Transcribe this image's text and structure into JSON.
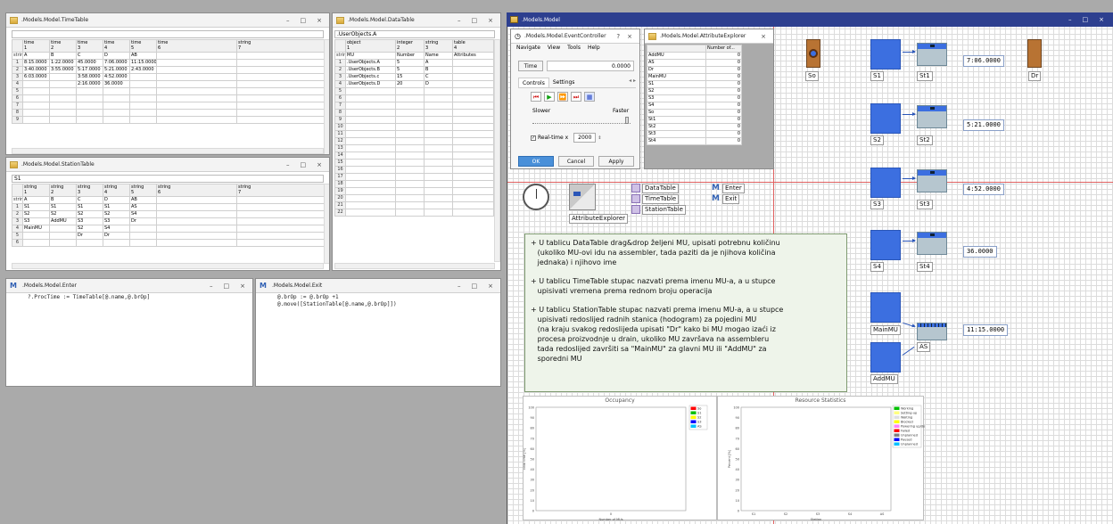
{
  "windows": {
    "timetable": {
      "title": ".Models.Model.TimeTable",
      "input": "",
      "headers": [
        {
          "type": "time",
          "idx": "1"
        },
        {
          "type": "time",
          "idx": "2"
        },
        {
          "type": "time",
          "idx": "3"
        },
        {
          "type": "time",
          "idx": "4"
        },
        {
          "type": "time",
          "idx": "5"
        },
        {
          "type": "time",
          "idx": "6"
        },
        {
          "type": "string",
          "idx": "7"
        }
      ],
      "subrow_label": "string",
      "subheaders": [
        "A",
        "B",
        "C",
        "D",
        "AB",
        "",
        ""
      ],
      "rows": [
        [
          "1",
          "8:15.0000",
          "1:22.0000",
          "45.0000",
          "7:06.0000",
          "11:15.0000",
          "",
          ""
        ],
        [
          "2",
          "3:40.0000",
          "3:55.0000",
          "5:17.0000",
          "5:21.0000",
          "2:43.0000",
          "",
          ""
        ],
        [
          "3",
          "6:03.0000",
          "",
          "3:58.0000",
          "4:52.0000",
          "",
          "",
          ""
        ],
        [
          "4",
          "",
          "",
          "2:16.0000",
          "36.0000",
          "",
          "",
          ""
        ],
        [
          "5",
          "",
          "",
          "",
          "",
          "",
          "",
          ""
        ],
        [
          "6",
          "",
          "",
          "",
          "",
          "",
          "",
          ""
        ],
        [
          "7",
          "",
          "",
          "",
          "",
          "",
          "",
          ""
        ],
        [
          "8",
          "",
          "",
          "",
          "",
          "",
          "",
          ""
        ],
        [
          "9",
          "",
          "",
          "",
          "",
          "",
          "",
          ""
        ]
      ]
    },
    "datatable": {
      "title": ".Models.Model.DataTable",
      "input": ".UserObjects.A",
      "headers": [
        {
          "type": "object",
          "idx": "1"
        },
        {
          "type": "integer",
          "idx": "2"
        },
        {
          "type": "string",
          "idx": "3"
        },
        {
          "type": "table",
          "idx": "4"
        }
      ],
      "subrow_label": "string",
      "subheaders": [
        "MU",
        "Number",
        "Name",
        "Attributes"
      ],
      "rows": [
        [
          "1",
          ".UserObjects.A",
          "5",
          "A",
          ""
        ],
        [
          "2",
          ".UserObjects.B",
          "5",
          "B",
          ""
        ],
        [
          "3",
          ".UserObjects.c",
          "15",
          "C",
          ""
        ],
        [
          "4",
          ".UserObjects.D",
          "20",
          "D",
          ""
        ],
        [
          "5",
          "",
          "",
          "",
          ""
        ],
        [
          "6",
          "",
          "",
          "",
          ""
        ],
        [
          "7",
          "",
          "",
          "",
          ""
        ],
        [
          "8",
          "",
          "",
          "",
          ""
        ],
        [
          "9",
          "",
          "",
          "",
          ""
        ],
        [
          "10",
          "",
          "",
          "",
          ""
        ],
        [
          "11",
          "",
          "",
          "",
          ""
        ],
        [
          "12",
          "",
          "",
          "",
          ""
        ],
        [
          "13",
          "",
          "",
          "",
          ""
        ],
        [
          "14",
          "",
          "",
          "",
          ""
        ],
        [
          "15",
          "",
          "",
          "",
          ""
        ],
        [
          "16",
          "",
          "",
          "",
          ""
        ],
        [
          "17",
          "",
          "",
          "",
          ""
        ],
        [
          "18",
          "",
          "",
          "",
          ""
        ],
        [
          "19",
          "",
          "",
          "",
          ""
        ],
        [
          "20",
          "",
          "",
          "",
          ""
        ],
        [
          "21",
          "",
          "",
          "",
          ""
        ],
        [
          "22",
          "",
          "",
          "",
          ""
        ]
      ]
    },
    "stationtable": {
      "title": ".Models.Model.StationTable",
      "input": "S1",
      "headers": [
        {
          "type": "string",
          "idx": "1"
        },
        {
          "type": "string",
          "idx": "2"
        },
        {
          "type": "string",
          "idx": "3"
        },
        {
          "type": "string",
          "idx": "4"
        },
        {
          "type": "string",
          "idx": "5"
        },
        {
          "type": "string",
          "idx": "6"
        },
        {
          "type": "string",
          "idx": "7"
        }
      ],
      "subrow_label": "string",
      "subheaders": [
        "A",
        "B",
        "C",
        "D",
        "AB",
        "",
        ""
      ],
      "rows": [
        [
          "1",
          "S1",
          "S1",
          "S1",
          "S1",
          "AS",
          "",
          ""
        ],
        [
          "2",
          "S2",
          "S2",
          "S2",
          "S2",
          "S4",
          "",
          ""
        ],
        [
          "3",
          "S3",
          "AddMU",
          "S3",
          "S3",
          "Dr",
          "",
          ""
        ],
        [
          "4",
          "MainMU",
          "",
          "S2",
          "S4",
          "",
          "",
          ""
        ],
        [
          "5",
          "",
          "",
          "Dr",
          "Dr",
          "",
          "",
          ""
        ],
        [
          "6",
          "",
          "",
          "",
          "",
          "",
          "",
          ""
        ]
      ]
    },
    "enter": {
      "title": ".Models.Model.Enter",
      "code": "?.ProcTime := TimeTable[@.name,@.brOp]"
    },
    "exit": {
      "title": ".Models.Model.Exit",
      "code": "@.brOp := @.brOp +1\n@.move([StationTable[@.name,@.brOp]])"
    },
    "model": {
      "title": ".Models.Model"
    },
    "eventcontroller": {
      "title": ".Models.Model.EventController",
      "help": "?",
      "menu": [
        "Navigate",
        "View",
        "Tools",
        "Help"
      ],
      "time_label": "Time",
      "time_value": "0.0000",
      "tabs": [
        "Controls",
        "Settings"
      ],
      "slower": "Slower",
      "faster": "Faster",
      "realtime_label": "Real-time x",
      "realtime_value": "2000",
      "ok": "OK",
      "cancel": "Cancel",
      "apply": "Apply"
    },
    "attributeexplorer": {
      "title": ".Models.Model.AttributeExplorer",
      "col_header": "Number of...",
      "rows": [
        [
          "AddMU",
          "0"
        ],
        [
          "AS",
          "0"
        ],
        [
          "Dr",
          "0"
        ],
        [
          "MainMU",
          "0"
        ],
        [
          "S1",
          "0"
        ],
        [
          "S2",
          "0"
        ],
        [
          "S3",
          "0"
        ],
        [
          "S4",
          "0"
        ],
        [
          "So",
          "0"
        ],
        [
          "St1",
          "0"
        ],
        [
          "St2",
          "0"
        ],
        [
          "St3",
          "0"
        ],
        [
          "St4",
          "0"
        ]
      ]
    }
  },
  "model_objects": {
    "so": "So",
    "dr": "Dr",
    "s1": "S1",
    "s2": "S2",
    "s3": "S3",
    "s4": "S4",
    "st1": "St1",
    "st2": "St2",
    "st3": "St3",
    "st4": "St4",
    "mainmu": "MainMU",
    "addmu": "AddMU",
    "as": "AS",
    "t1": "7:06.0000",
    "t2": "5:21.0000",
    "t3": "4:52.0000",
    "t4": "36.0000",
    "t5": "11:15.0000",
    "datatable": "DataTable",
    "timetable": "TimeTable",
    "stationtable": "StationTable",
    "enter": "Enter",
    "exit": "Exit",
    "attrexplorer": "AttributeExplorer",
    "m_letter": "M"
  },
  "instructions": [
    "+ U tablicu DataTable drag&drop željeni MU, upisati potrebnu količinu\n   (ukoliko MU-ovi idu na assembler, tada paziti da je njihova količina\n   jednaka) i njihovo ime",
    "+ U tablicu TimeTable stupac nazvati prema imenu MU-a, a u stupce\n   upisivati vremena prema rednom broju operacija",
    "+ U tablicu StationTable stupac nazvati prema imenu MU-a, a u stupce\n   upisivati redoslijed radnih stanica (hodogram) za pojedini MU\n   (na kraju svakog redoslijeda upisati \"Dr\" kako bi MU mogao izaći iz\n   procesa proizvodnje u drain, ukoliko MU završava na assembleru\n   tada redoslijed završiti sa \"MainMU\" za glavni MU ili \"AddMU\" za\n   sporedni MU"
  ],
  "occupancy": {
    "title": "Occupancy",
    "legend": [
      "So",
      "S1",
      "S2",
      "S3",
      "AS"
    ],
    "legend_colors": [
      "#ff0000",
      "#00c000",
      "#ffff00",
      "#0000ff",
      "#00c0ff"
    ],
    "yticks": [
      "100",
      "90",
      "80",
      "70",
      "60",
      "50",
      "40",
      "30",
      "20",
      "10",
      "0"
    ],
    "xtick": "0",
    "xlabel": "Number of MUs",
    "ylabel": "Total time [%]"
  },
  "resource": {
    "title": "Resource Statistics",
    "legend": [
      "Working",
      "Setting-up",
      "Waiting",
      "Blocked",
      "Powering up/down",
      "Failed",
      "Unplanned",
      "Paused",
      "Unplanned"
    ],
    "legend_colors": [
      "#00c000",
      "#ffff80",
      "#e0e0e0",
      "#ffff00",
      "#ff80ff",
      "#ff0000",
      "#808080",
      "#0000ff",
      "#00c0ff"
    ],
    "yticks": [
      "100",
      "90",
      "80",
      "70",
      "60",
      "50",
      "40",
      "30",
      "20",
      "10",
      "0"
    ],
    "xticks": [
      "S1",
      "S2",
      "S3",
      "S4",
      "AS"
    ],
    "xlabel": "Station",
    "ylabel": "Percent [%]"
  }
}
